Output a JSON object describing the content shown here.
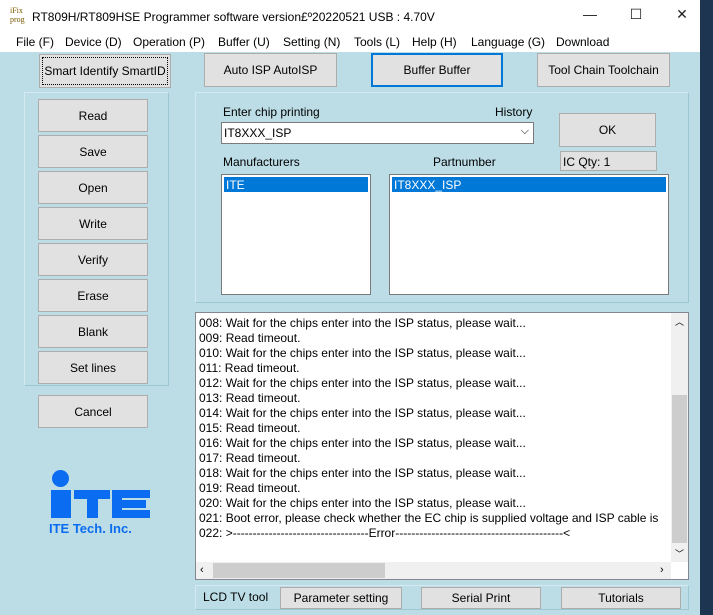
{
  "window": {
    "title": "RT809H/RT809HSE Programmer software version£º20220521  USB : 4.70V",
    "app_icon_text": "iFix prog",
    "minimize": "—",
    "maximize": "☐",
    "close": "✕"
  },
  "menu": [
    "File (F)",
    "Device (D)",
    "Operation (P)",
    "Buffer (U)",
    "Setting (N)",
    "Tools (L)",
    "Help (H)",
    "Language (G)",
    "Download"
  ],
  "top_buttons": [
    "Smart Identify SmartID",
    "Auto ISP AutoISP",
    "Buffer Buffer",
    "Tool Chain Toolchain"
  ],
  "left_buttons": [
    "Read",
    "Save",
    "Open",
    "Write",
    "Verify",
    "Erase",
    "Blank",
    "Set lines"
  ],
  "cancel": "Cancel",
  "logo": {
    "mark": "iTE",
    "text": "ITE Tech. Inc.",
    "color": "#0a6cf0"
  },
  "chip": {
    "enter_label": "Enter chip printing",
    "history_label": "History",
    "value": "IT8XXX_ISP",
    "ok": "OK",
    "ic_qty": "IC Qty: 1",
    "manufacturers_label": "Manufacturers",
    "partnumber_label": "Partnumber",
    "manufacturers": [
      "ITE"
    ],
    "partnumbers": [
      "IT8XXX_ISP"
    ]
  },
  "log": [
    "008:  Wait for the chips enter into the ISP status, please wait...",
    "009:  Read timeout.",
    "010:  Wait for the chips enter into the ISP status, please wait...",
    "011:  Read timeout.",
    "012:  Wait for the chips enter into the ISP status, please wait...",
    "013:  Read timeout.",
    "014:  Wait for the chips enter into the ISP status, please wait...",
    "015:  Read timeout.",
    "016:  Wait for the chips enter into the ISP status, please wait...",
    "017:  Read timeout.",
    "018:  Wait for the chips enter into the ISP status, please wait...",
    "019:  Read timeout.",
    "020:  Wait for the chips enter into the ISP status, please wait...",
    "021:  Boot error, please check whether the EC chip is supplied voltage and ISP cable is",
    "022:  >----------------------------------Error------------------------------------------<"
  ],
  "bottom": {
    "label": "LCD TV tool",
    "buttons": [
      "Parameter setting",
      "Serial Print",
      "Tutorials"
    ]
  }
}
